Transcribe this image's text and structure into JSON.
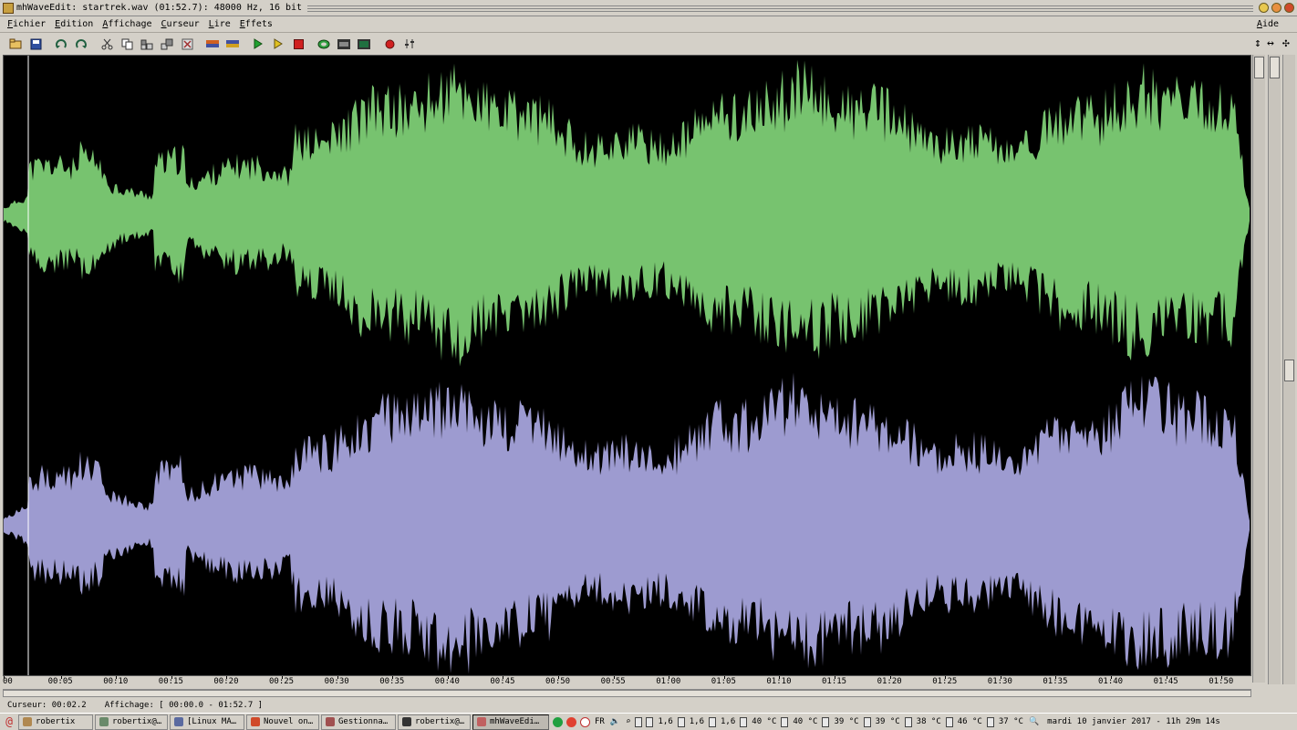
{
  "window": {
    "title": "mhWaveEdit: startrek.wav (01:52.7): 48000 Hz, 16 bit"
  },
  "menu": {
    "items": [
      "Fichier",
      "Edition",
      "Affichage",
      "Curseur",
      "Lire",
      "Effets"
    ],
    "help": "Aide"
  },
  "toolbar": {
    "buttons": [
      {
        "icon": "open-icon"
      },
      {
        "icon": "save-icon"
      },
      {
        "icon": "undo-icon"
      },
      {
        "icon": "redo-icon"
      },
      {
        "icon": "cut-icon"
      },
      {
        "icon": "copy-icon"
      },
      {
        "icon": "paste-icon"
      },
      {
        "icon": "paste-over-icon"
      },
      {
        "icon": "delete-icon"
      },
      {
        "icon": "crop-icon"
      },
      {
        "icon": "silence-icon"
      },
      {
        "icon": "play-icon"
      },
      {
        "icon": "play-selection-icon"
      },
      {
        "icon": "stop-icon"
      },
      {
        "icon": "loop-icon"
      },
      {
        "icon": "mixer-icon"
      },
      {
        "icon": "record-mode-icon"
      },
      {
        "icon": "record-icon"
      },
      {
        "icon": "volume-icon"
      }
    ]
  },
  "waveform": {
    "channel1_color": "#77c36f",
    "channel2_color": "#9d9bd0",
    "background": "#000000"
  },
  "timeline": {
    "labels": [
      "00",
      "00:05",
      "00:10",
      "00:15",
      "00:20",
      "00:25",
      "00:30",
      "00:35",
      "00:40",
      "00:45",
      "00:50",
      "00:55",
      "01:00",
      "01:05",
      "01:10",
      "01:15",
      "01:20",
      "01:25",
      "01:30",
      "01:35",
      "01:40",
      "01:45",
      "01:50"
    ]
  },
  "status": {
    "cursor": "Curseur: 00:02.2",
    "view": "Affichage: [ 00:00.0 - 01:52.7 ]"
  },
  "taskbar": {
    "tasks": [
      {
        "label": "robertix",
        "color": "#b08850"
      },
      {
        "label": "robertix@…",
        "color": "#6a8a6a"
      },
      {
        "label": "[Linux MA…",
        "color": "#5a6aa0"
      },
      {
        "label": "Nouvel on…",
        "color": "#d04a2a"
      },
      {
        "label": "Gestionna…",
        "color": "#a05050"
      },
      {
        "label": "robertix@…",
        "color": "#333333"
      },
      {
        "label": "mhWaveEdi…",
        "color": "#c06060",
        "active": true
      }
    ],
    "lang": "FR",
    "temps": [
      "1,6",
      "1,6",
      "1,6",
      "40 °C",
      "40 °C",
      "39 °C",
      "39 °C",
      "38 °C",
      "46 °C",
      "37 °C"
    ],
    "clock": "mardi 10 janvier 2017 - 11h 29m 14s"
  }
}
